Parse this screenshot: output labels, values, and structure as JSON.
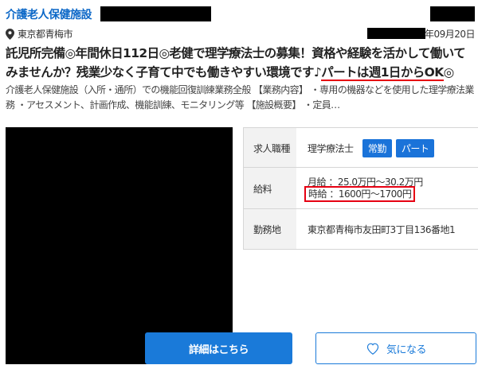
{
  "listing": {
    "facility_type": "介護老人保健施設",
    "location": "東京都青梅市",
    "date_suffix": "年09月20日",
    "headline_part1": "託児所完備◎年間休日112日◎老健で理学療法士の募集！資格や経験を活かして働いてみませんか？残業少なく子育て中でも働きやすい環境です♪",
    "headline_highlight": "パートは週1日からOK",
    "headline_end": "◎",
    "description": "介護老人保健施設（入所・通所）での機能回復訓練業務全般 【業務内容】 ・専用の機器などを使用した理学療法業務 ・アセスメント、計画作成、機能訓練、モニタリング等 【施設概要】 ・定員…"
  },
  "details": {
    "job_label": "求人職種",
    "job_value": "理学療法士",
    "tags": [
      "常勤",
      "パート"
    ],
    "salary_label": "給料",
    "monthly": "月給 ：25.0万円〜30.2万円",
    "hourly": "時給 ：1600円〜1700円",
    "workplace_label": "勤務地",
    "workplace_value": "東京都青梅市友田町3丁目136番地1"
  },
  "buttons": {
    "detail": "詳細はこちら",
    "favorite": "気になる"
  },
  "icons": {
    "location": "map-pin-icon",
    "heart": "heart-icon"
  },
  "colors": {
    "link": "#0b67c7",
    "accent_blue": "#1a7ad9",
    "highlight_red": "#e60012"
  }
}
